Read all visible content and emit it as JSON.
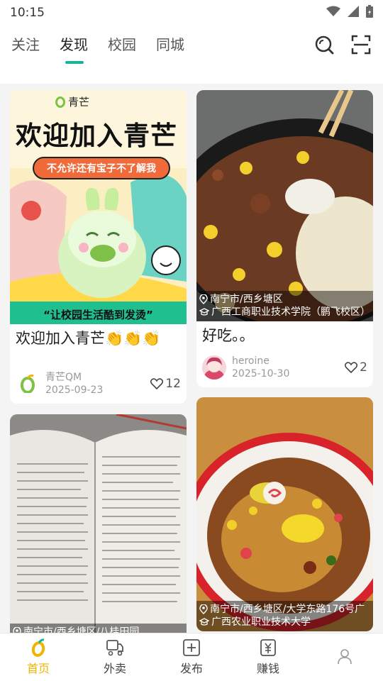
{
  "status": {
    "time": "10:15"
  },
  "tabs": [
    {
      "label": "关注"
    },
    {
      "label": "发现"
    },
    {
      "label": "校园"
    },
    {
      "label": "同城"
    }
  ],
  "accent_color": "#18b49b",
  "cards": [
    {
      "poster": {
        "brand": "青芒",
        "headline": "欢迎加入青芒",
        "bubble": "不允许还有宝子不了解我",
        "slogan": "“让校园生活酷到发烫”"
      },
      "title": "欢迎加入青芒👏👏👏",
      "author": "青芒QM",
      "date": "2025-09-23",
      "likes": "12"
    },
    {
      "location": "南宁市/西乡塘区",
      "school": "广西工商职业技术学院（鹏飞校区）",
      "title": "好吃。。",
      "author": "heroine",
      "date": "2025-10-30",
      "likes": "2"
    },
    {
      "location": "南宁市/西乡塘区/八桂田园"
    },
    {
      "location": "南宁市/西乡塘区/大学东路176号广",
      "school": "广西农业职业技术大学"
    }
  ],
  "bottom_nav": [
    {
      "label": "首页",
      "icon": "home-logo-icon"
    },
    {
      "label": "外卖",
      "icon": "delivery-icon"
    },
    {
      "label": "发布",
      "icon": "plus-square-icon"
    },
    {
      "label": "赚钱",
      "icon": "money-icon"
    },
    {
      "label": "",
      "icon": "profile-icon"
    }
  ]
}
